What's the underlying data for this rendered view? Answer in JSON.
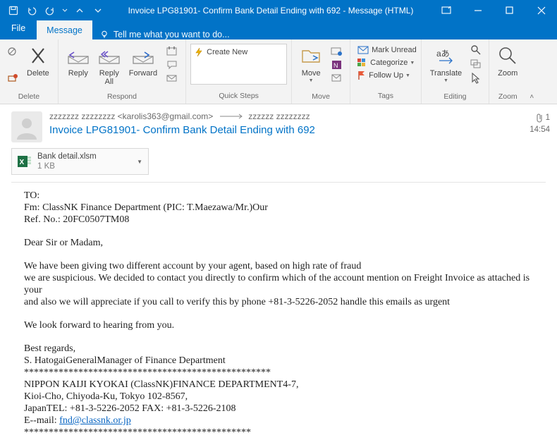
{
  "window": {
    "title": "Invoice LPG81901- Confirm Bank Detail Ending with 692 - Message (HTML)"
  },
  "tabs": {
    "file": "File",
    "message": "Message",
    "tell_me": "Tell me what you want to do..."
  },
  "ribbon": {
    "groups": {
      "delete": "Delete",
      "respond": "Respond",
      "quick_steps": "Quick Steps",
      "move": "Move",
      "tags": "Tags",
      "editing": "Editing",
      "zoom": "Zoom"
    },
    "delete_btn": "Delete",
    "reply": "Reply",
    "reply_all": "Reply\nAll",
    "forward": "Forward",
    "create_new": "Create New",
    "move_btn": "Move",
    "mark_unread": "Mark Unread",
    "categorize": "Categorize",
    "follow_up": "Follow Up",
    "translate": "Translate",
    "zoom_btn": "Zoom"
  },
  "header": {
    "from_display": "zzzzzzz zzzzzzzz <karolis363@gmail.com>",
    "to_display": "zzzzzz zzzzzzzz",
    "subject": "Invoice LPG81901- Confirm Bank Detail Ending with 692",
    "attach_count": "1",
    "time": "14:54"
  },
  "attachment": {
    "name": "Bank detail.xlsm",
    "size": "1 KB"
  },
  "body": {
    "l1": "TO:",
    "l2": "Fm: ClassNK Finance Department (PIC: T.Maezawa/Mr.)Our",
    "l3": "Ref. No.: 20FC0507TM08",
    "l4": "Dear Sir or Madam,",
    "l5": "We have been giving two different account by your agent, based on high rate of fraud",
    "l6": "we are suspicious. We decided to contact you directly to confirm which of the account mention on Freight Invoice as attached is your",
    "l7": "and also we will appreciate if you call to verify this by phone  +81-3-5226-2052  handle  this emails as urgent",
    "l8": "We look forward to hearing from you.",
    "l9": "Best regards,",
    "l10": "S. HatogaiGeneralManager of Finance Department",
    "stars1": "**************************************************",
    "l11": "NIPPON KAIJI KYOKAI (ClassNK)FINANCE DEPARTMENT4-7,",
    "l12": "Kioi-Cho, Chiyoda-Ku, Tokyo 102-8567,",
    "l13": "JapanTEL: +81-3-5226-2052 FAX: +81-3-5226-2108",
    "l14a": "E--mail: ",
    "l14b": "fnd@classnk.or.jp",
    "stars2": "**********************************************"
  }
}
